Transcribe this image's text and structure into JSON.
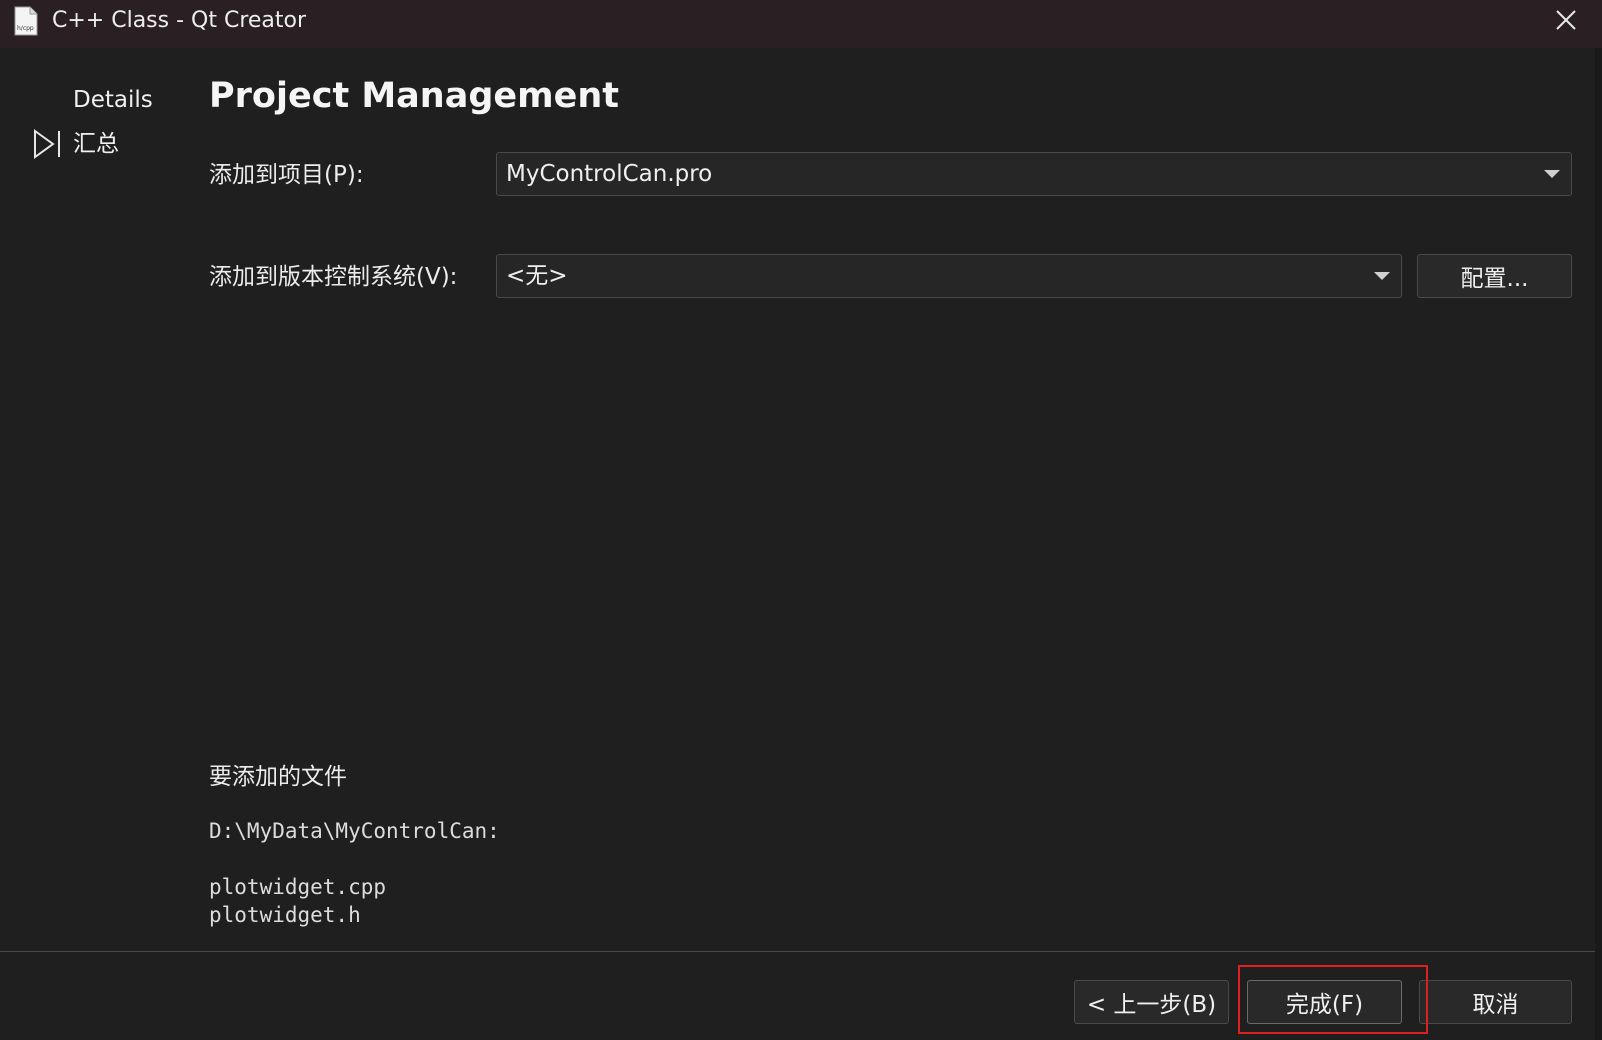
{
  "window": {
    "title": "C++ Class - Qt Creator",
    "icon_text": "h/cpp"
  },
  "nav": {
    "items": [
      {
        "label": "Details"
      },
      {
        "label": "汇总",
        "current": true
      }
    ]
  },
  "page": {
    "title": "Project Management"
  },
  "form": {
    "project_label": "添加到项目(P):",
    "project_value": "MyControlCan.pro",
    "vcs_label": "添加到版本控制系统(V):",
    "vcs_value": "<无>",
    "configure_label": "配置..."
  },
  "files": {
    "heading": "要添加的文件",
    "path": "D:\\MyData\\MyControlCan:",
    "list": [
      "plotwidget.cpp",
      "plotwidget.h"
    ]
  },
  "footer": {
    "back_label": "< 上一步(B)",
    "finish_label": "完成(F)",
    "cancel_label": "取消"
  },
  "colors": {
    "background": "#1f1f1f",
    "titlebar": "#2a1f22",
    "highlight": "#e02020"
  }
}
